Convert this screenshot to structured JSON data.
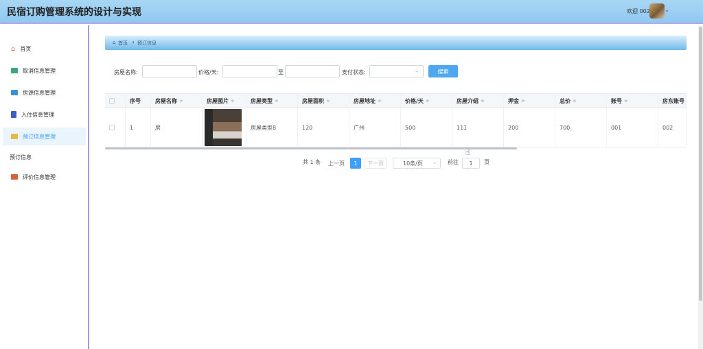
{
  "app": {
    "title": "民宿订购管理系统的设计与实现",
    "welcome": "欢迎 002"
  },
  "sidebar": {
    "items": [
      {
        "label": "首页",
        "icon": "home-icon",
        "color": "#e06c5a"
      },
      {
        "label": "取消信息管理",
        "icon": "envelope-icon",
        "color": "#3aa87a"
      },
      {
        "label": "房源信息管理",
        "icon": "folder-icon",
        "color": "#3b8fd8"
      },
      {
        "label": "入住信息管理",
        "icon": "book-icon",
        "color": "#3b5fc0"
      },
      {
        "label": "预订信息管理",
        "icon": "card-icon",
        "color": "#e8b84a"
      },
      {
        "label": "评价信息管理",
        "icon": "image-icon",
        "color": "#d9603a"
      }
    ],
    "sub_label": "预订信息"
  },
  "breadcrumb": {
    "home": "首页",
    "sep": "•",
    "current": "预订信息"
  },
  "search": {
    "room_name_label": "房屋名称:",
    "price_label": "价格/天:",
    "range_sep": "至",
    "pay_status_label": "支付状态:",
    "search_button": "搜索"
  },
  "table": {
    "columns": [
      "序号",
      "房屋名称",
      "房屋图片",
      "房屋类型",
      "房屋面积",
      "房屋地址",
      "价格/天",
      "房屋介绍",
      "押金",
      "总价",
      "账号",
      "房东账号"
    ],
    "rows": [
      {
        "index": "1",
        "name": "房",
        "type": "房屋类型8",
        "area": "120",
        "address": "广州",
        "price": "500",
        "intro": "111",
        "deposit": "200",
        "total": "700",
        "account": "001",
        "owner": "002"
      }
    ]
  },
  "pagination": {
    "total": "共 1 条",
    "prev": "上一页",
    "current": "1",
    "next": "下一页",
    "page_size": "10条/页",
    "goto": "前往",
    "goto_value": "1",
    "page_unit": "页"
  }
}
